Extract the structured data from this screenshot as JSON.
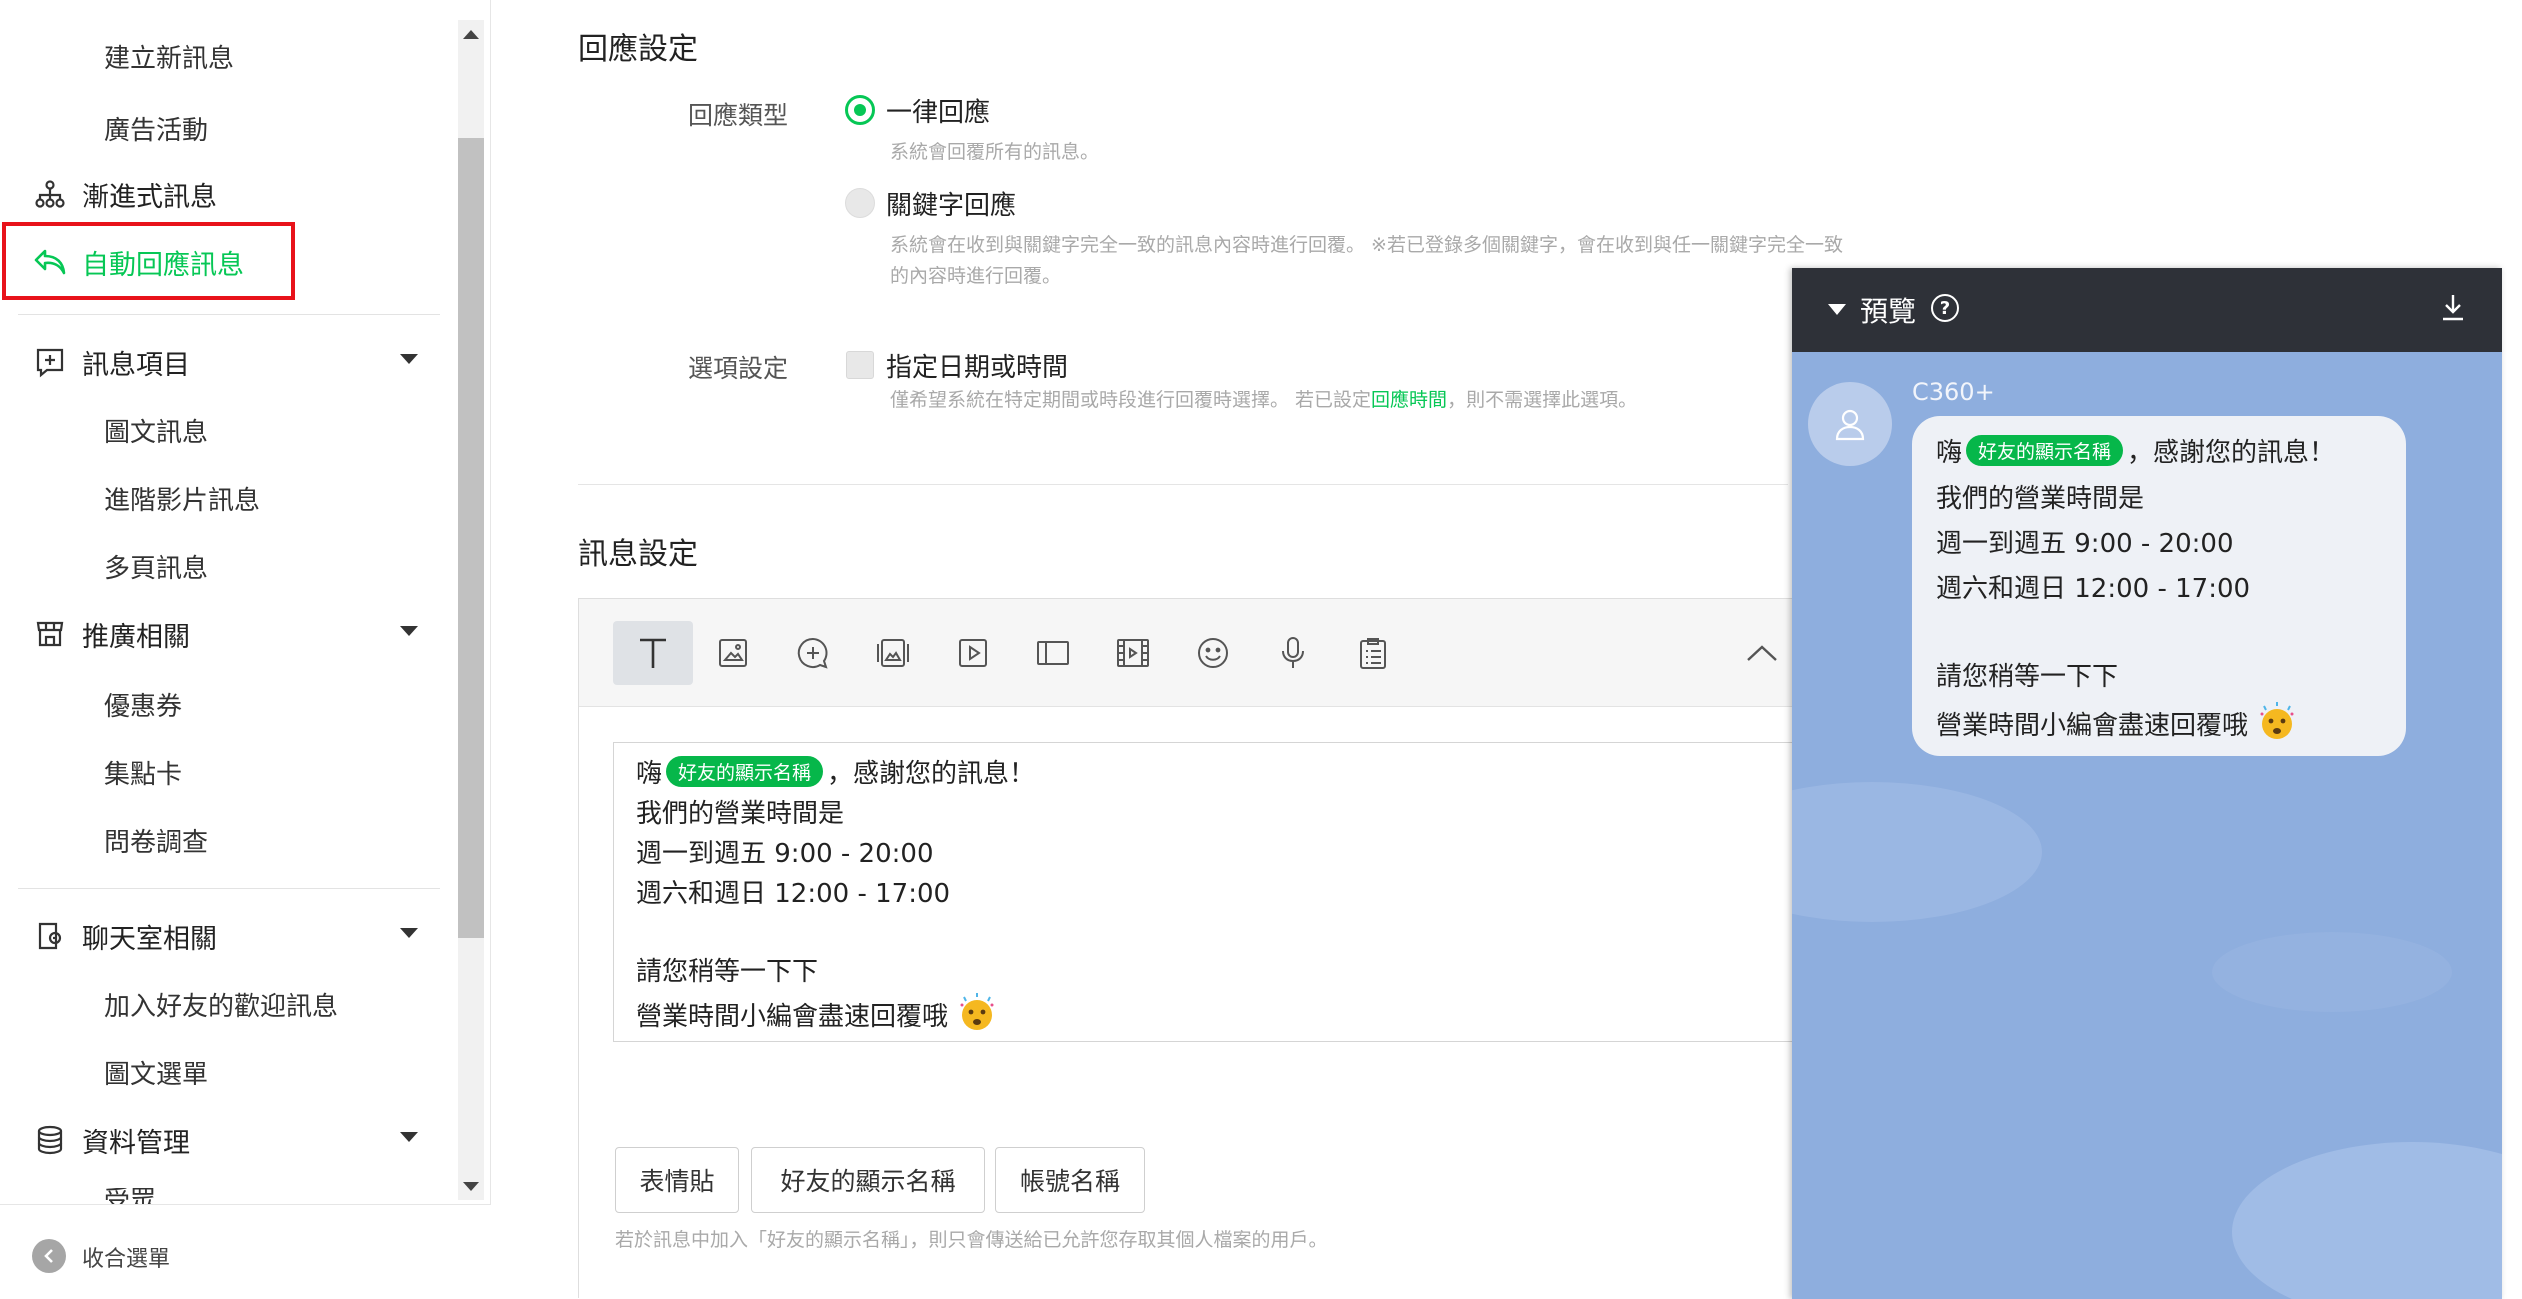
{
  "sidebar": {
    "sub_items_top": [
      "建立新訊息",
      "廣告活動"
    ],
    "progressive": "漸進式訊息",
    "auto_reply": "自動回應訊息",
    "message_items": {
      "label": "訊息項目",
      "children": [
        "圖文訊息",
        "進階影片訊息",
        "多頁訊息"
      ]
    },
    "promotion": {
      "label": "推廣相關",
      "children": [
        "優惠券",
        "集點卡",
        "問卷調查"
      ]
    },
    "chat": {
      "label": "聊天室相關",
      "children": [
        "加入好友的歡迎訊息",
        "圖文選單"
      ]
    },
    "data": {
      "label": "資料管理",
      "children": [
        "受眾"
      ]
    },
    "collapse": "收合選單",
    "accent_color": "#06c755",
    "highlight_color": "#e8121a"
  },
  "response_settings": {
    "title": "回應設定",
    "type_label": "回應類型",
    "option_all": "一律回應",
    "option_all_hint": "系統會回覆所有的訊息。",
    "option_keyword": "關鍵字回應",
    "option_keyword_hint_1": "系統會在收到與關鍵字完全一致的訊息內容時進行回覆。 ※若已登錄多個關鍵字，會在收到與任一關鍵字完全一致",
    "option_keyword_hint_2": "的內容時進行回覆。",
    "options_label": "選項設定",
    "checkbox_label": "指定日期或時間",
    "checkbox_hint_pre": "僅希望系統在特定期間或時段進行回覆時選擇。 若已設定",
    "checkbox_hint_link": "回應時間",
    "checkbox_hint_post": "，則不需選擇此選項。"
  },
  "message_settings": {
    "title": "訊息設定",
    "toolbar_icons": [
      "text-icon",
      "image-icon",
      "sticker-chat-icon",
      "card-icon",
      "video-icon",
      "coupon-icon",
      "film-icon",
      "emoji-icon",
      "microphone-icon",
      "clipboard-icon",
      "chevron-up-icon"
    ],
    "message": {
      "greeting_pre": "嗨",
      "tag": "好友的顯示名稱",
      "greeting_post": "，感謝您的訊息！",
      "line2": "我們的營業時間是",
      "line3": "週一到週五 9:00  - 20:00",
      "line4": "週六和週日 12:00 - 17:00",
      "line6": "請您稍等一下下",
      "line7": "營業時間小編會盡速回覆哦"
    },
    "insert_buttons": [
      "表情貼",
      "好友的顯示名稱",
      "帳號名稱"
    ],
    "footer_hint": "若於訊息中加入「好友的顯示名稱」，則只會傳送給已允許您存取其個人檔案的用戶。"
  },
  "preview": {
    "title": "預覽",
    "account_name": "C360+"
  }
}
